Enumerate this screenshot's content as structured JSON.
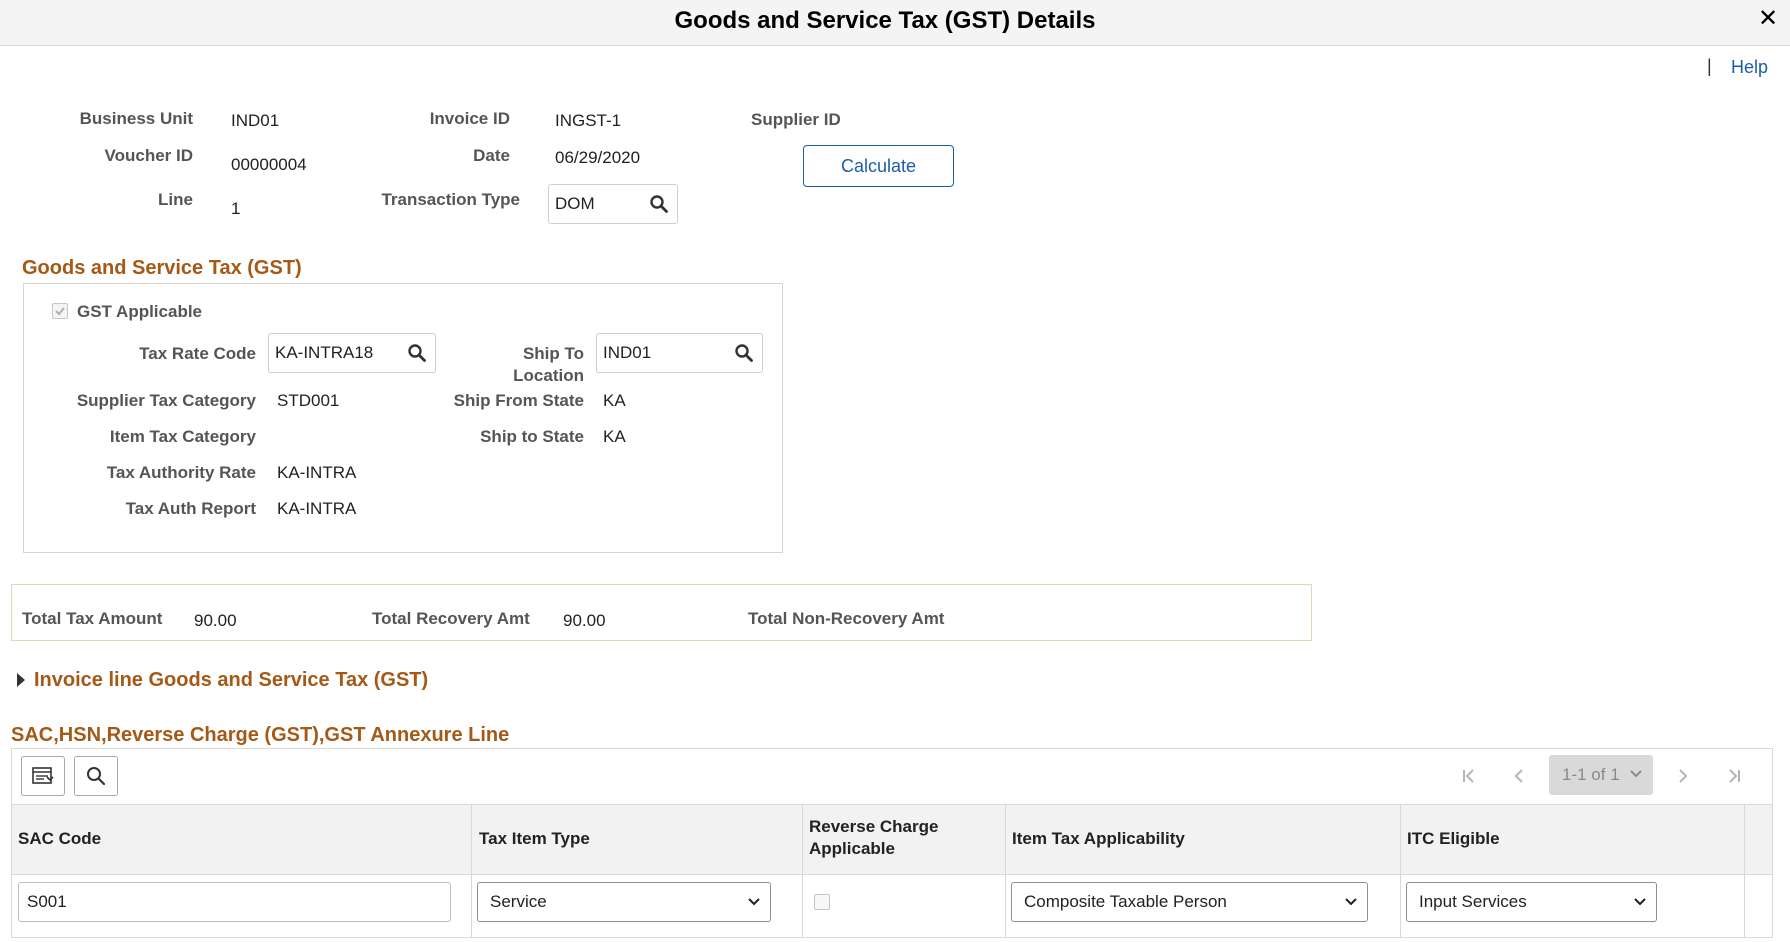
{
  "header": {
    "title": "Goods and Service Tax (GST) Details",
    "close_glyph": "✕"
  },
  "help": {
    "separator": "|",
    "label": "Help"
  },
  "info": {
    "business_unit_label": "Business Unit",
    "business_unit": "IND01",
    "invoice_id_label": "Invoice ID",
    "invoice_id": "INGST-1",
    "supplier_id_label": "Supplier ID",
    "voucher_id_label": "Voucher ID",
    "voucher_id": "00000004",
    "date_label": "Date",
    "date": "06/29/2020",
    "line_label": "Line",
    "line": "1",
    "transaction_type_label": "Transaction Type",
    "transaction_type": "DOM",
    "calculate_label": "Calculate"
  },
  "gst": {
    "section_title": "Goods and Service Tax (GST)",
    "applicable_label": "GST Applicable",
    "applicable_checked": true,
    "tax_rate_code_label": "Tax Rate Code",
    "tax_rate_code": "KA-INTRA18",
    "ship_to_location_label_1": "Ship To",
    "ship_to_location_label_2": "Location",
    "ship_to_location": "IND01",
    "supplier_tax_category_label": "Supplier Tax Category",
    "supplier_tax_category": "STD001",
    "ship_from_state_label": "Ship From State",
    "ship_from_state": "KA",
    "item_tax_category_label": "Item Tax Category",
    "ship_to_state_label": "Ship to State",
    "ship_to_state": "KA",
    "tax_authority_rate_label": "Tax Authority Rate",
    "tax_authority_rate": "KA-INTRA",
    "tax_auth_report_label": "Tax Auth Report",
    "tax_auth_report": "KA-INTRA"
  },
  "totals": {
    "total_tax_label": "Total Tax Amount",
    "total_tax": "90.00",
    "total_recovery_label": "Total Recovery Amt",
    "total_recovery": "90.00",
    "total_nonrecovery_label": "Total Non-Recovery Amt"
  },
  "invoice_line": {
    "title": "Invoice line Goods and Service Tax (GST)"
  },
  "grid": {
    "title": "SAC,HSN,Reverse Charge (GST),GST Annexure Line",
    "pagination": "1-1 of 1",
    "columns": {
      "sac_code": "SAC Code",
      "tax_item_type": "Tax Item Type",
      "reverse_charge_1": "Reverse Charge",
      "reverse_charge_2": "Applicable",
      "item_tax_applicability": "Item Tax Applicability",
      "itc_eligible": "ITC Eligible"
    },
    "rows": [
      {
        "sac_code": "S001",
        "tax_item_type": "Service",
        "reverse_charge": false,
        "item_tax_applicability": "Composite Taxable Person",
        "itc_eligible": "Input Services"
      }
    ]
  },
  "colors": {
    "accent": "#a55916",
    "link": "#1a5ea8",
    "header_bg": "#f4f4f4"
  },
  "icons": [
    "close-icon",
    "search-icon",
    "grid-personalize-icon",
    "expand-triangle-icon",
    "first-page-icon",
    "prev-page-icon",
    "next-page-icon",
    "last-page-icon",
    "chevron-down-icon",
    "checkmark-icon"
  ]
}
